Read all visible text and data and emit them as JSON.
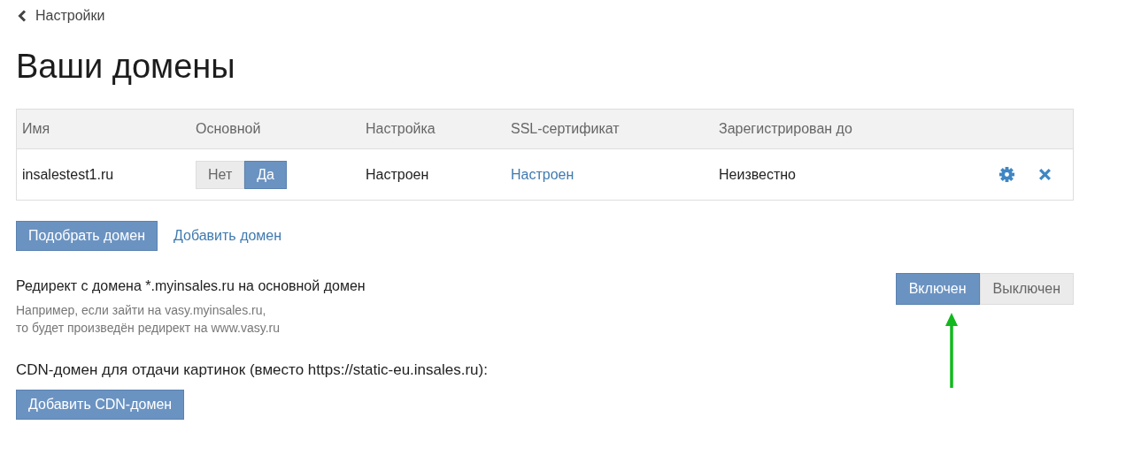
{
  "back_link": {
    "label": "Настройки"
  },
  "title": "Ваши домены",
  "table": {
    "columns": [
      "Имя",
      "Основной",
      "Настройка",
      "SSL-сертификат",
      "Зарегистрирован до"
    ],
    "rows": [
      {
        "name": "insalestest1.ru",
        "primary": [
          {
            "label": "Нет",
            "selected": false
          },
          {
            "label": "Да",
            "selected": true
          }
        ],
        "setup": "Настроен",
        "ssl": "Настроен",
        "registered_until": "Неизвестно"
      }
    ]
  },
  "actions": {
    "primary_button": "Подобрать домен",
    "link": "Добавить домен"
  },
  "redirect": {
    "title": "Редирект с домена *.myinsales.ru на основной домен",
    "hint_lines": [
      "Например, если зайти на vasy.myinsales.ru,",
      "то будет произведён редирект на www.vasy.ru"
    ],
    "options": [
      {
        "label": "Включен",
        "selected": true
      },
      {
        "label": "Выключен",
        "selected": false
      }
    ]
  },
  "cdn": {
    "title": "CDN-домен для отдачи картинок (вместо https://static-eu.insales.ru):",
    "button": "Добавить CDN-домен"
  }
}
